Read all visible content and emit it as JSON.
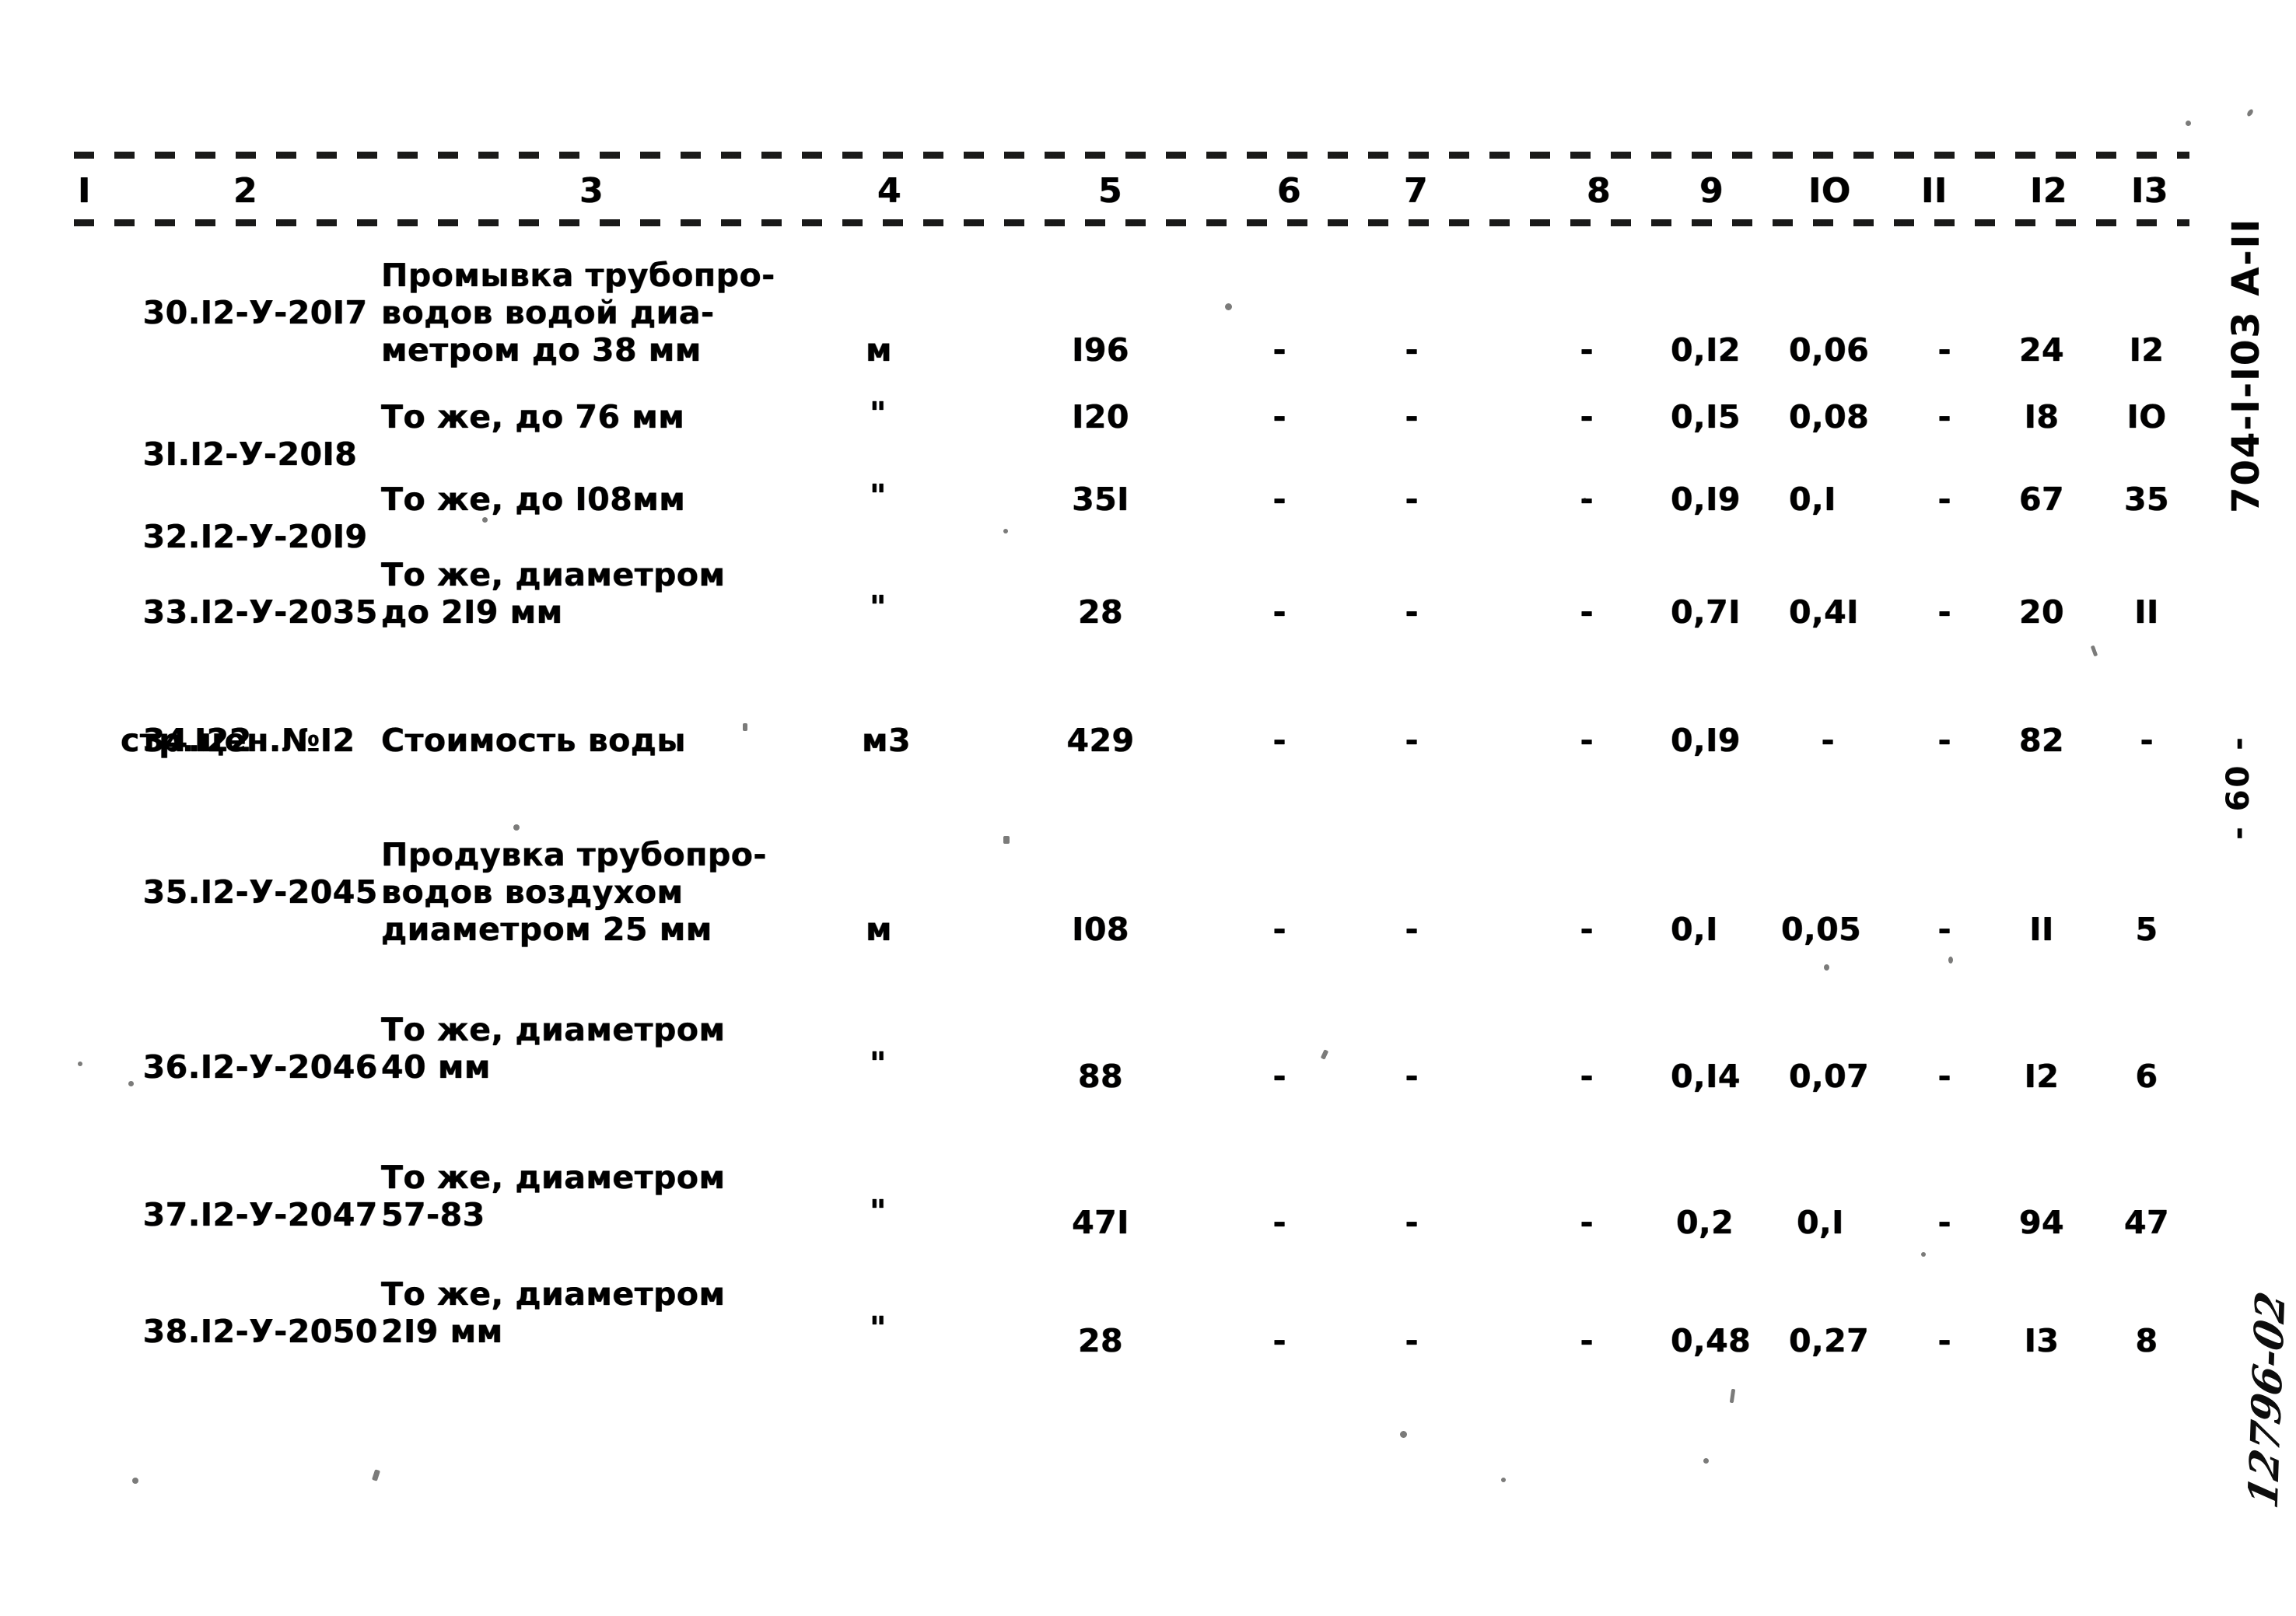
{
  "document": {
    "margin_code": "704-I-I03  А-II",
    "page_number": "- 60 -",
    "handwritten_mark": "12796-02"
  },
  "table": {
    "column_headers": [
      "I",
      "2",
      "3",
      "4",
      "5",
      "6",
      "7",
      "8",
      "9",
      "IO",
      "II",
      "I2",
      "I3"
    ],
    "rows": [
      {
        "num_code": "30.I2-У-20I7",
        "description": [
          "Промывка трубопро-",
          "водов водой диа-",
          "метром до 38 мм"
        ],
        "unit": "м",
        "c5": "I96",
        "c6": "-",
        "c7": "-",
        "c8": "-",
        "c9": "0,I2",
        "c10": "0,06",
        "c11": "-",
        "c12": "24",
        "c13": "I2"
      },
      {
        "num_code": "3I.I2-У-20I8",
        "description": [
          "То же, до 76 мм"
        ],
        "unit": "\"",
        "c5": "I20",
        "c6": "-",
        "c7": "-",
        "c8": "-",
        "c9": "0,I5",
        "c10": "0,08",
        "c11": "-",
        "c12": "I8",
        "c13": "IO"
      },
      {
        "num_code": "32.I2-У-20I9",
        "description": [
          "То же, до I08мм"
        ],
        "unit": "\"",
        "c5": "35I",
        "c6": "-",
        "c7": "-",
        "c8": "-",
        "c9": "0,I9",
        "c10": "0,I",
        "c11": "-",
        "c12": "67",
        "c13": "35"
      },
      {
        "num_code": "33.I2-У-2035",
        "description": [
          "То же, диаметром",
          "до 2I9 мм"
        ],
        "unit": "\"",
        "c5": "28",
        "c6": "-",
        "c7": "-",
        "c8": "-",
        "c9": "0,7I",
        "c10": "0,4I",
        "c11": "-",
        "c12": "20",
        "c13": "II"
      },
      {
        "num_code": "34.цен.№I2",
        "num_code2": "стр.I22",
        "description": [
          "Стоимость воды"
        ],
        "unit": "м3",
        "c5": "429",
        "c6": "-",
        "c7": "-",
        "c8": "-",
        "c9": "0,I9",
        "c10": "-",
        "c11": "-",
        "c12": "82",
        "c13": "-"
      },
      {
        "num_code": "35.I2-У-2045",
        "description": [
          "Продувка трубопро-",
          "водов воздухом",
          "диаметром 25 мм"
        ],
        "unit": "м",
        "c5": "I08",
        "c6": "-",
        "c7": "-",
        "c8": "-",
        "c9": "0,I",
        "c10": "0,05",
        "c11": "-",
        "c12": "II",
        "c13": "5"
      },
      {
        "num_code": "36.I2-У-2046",
        "description": [
          "То же, диаметром",
          "40 мм"
        ],
        "unit": "\"",
        "c5": "88",
        "c6": "-",
        "c7": "-",
        "c8": "-",
        "c9": "0,I4",
        "c10": "0,07",
        "c11": "-",
        "c12": "I2",
        "c13": "6"
      },
      {
        "num_code": "37.I2-У-2047",
        "description": [
          "То же, диаметром",
          "57-83"
        ],
        "unit": "\"",
        "c5": "47I",
        "c6": "-",
        "c7": "-",
        "c8": "-",
        "c9": "0,2",
        "c10": "0,I",
        "c11": "-",
        "c12": "94",
        "c13": "47"
      },
      {
        "num_code": "38.I2-У-2050",
        "description": [
          "То же, диаметром",
          "2I9 мм"
        ],
        "unit": "\"",
        "c5": "28",
        "c6": "-",
        "c7": "-",
        "c8": "-",
        "c9": "0,48",
        "c10": "0,27",
        "c11": "-",
        "c12": "I3",
        "c13": "8"
      }
    ]
  }
}
